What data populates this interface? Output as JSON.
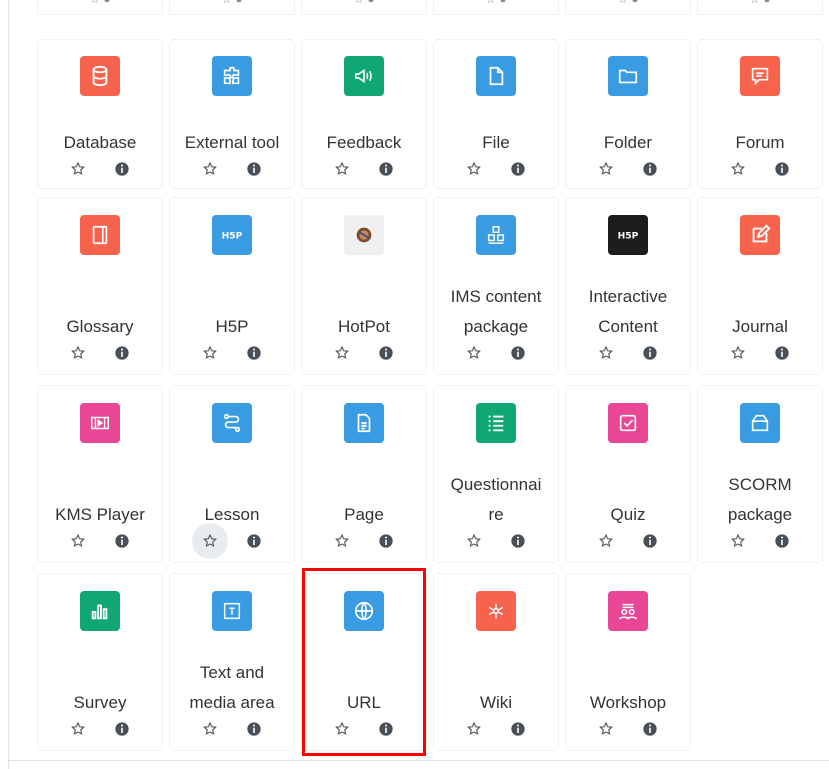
{
  "colors": {
    "orange": "#f7634d",
    "blue": "#399be2",
    "green": "#11a676",
    "pink": "#e94695",
    "hotpot": "#f0f0f0",
    "black": "#1d1d1b",
    "highlight": "#ff0000"
  },
  "tiles": [
    {
      "label": "Database",
      "icon": "database-icon",
      "color": "orange"
    },
    {
      "label": "External tool",
      "icon": "puzzle-icon",
      "color": "blue"
    },
    {
      "label": "Feedback",
      "icon": "megaphone-icon",
      "color": "green"
    },
    {
      "label": "File",
      "icon": "file-icon",
      "color": "blue"
    },
    {
      "label": "Folder",
      "icon": "folder-icon",
      "color": "blue"
    },
    {
      "label": "Forum",
      "icon": "forum-icon",
      "color": "orange"
    },
    {
      "label": "Glossary",
      "icon": "book-icon",
      "color": "orange"
    },
    {
      "label": "H5P",
      "icon": "h5p-icon",
      "color": "blue",
      "text": "H5P"
    },
    {
      "label": "HotPot",
      "icon": "hotpot-icon",
      "color": "hotpot"
    },
    {
      "label": "IMS content package",
      "lines": [
        "IMS content",
        "package"
      ],
      "icon": "boxes-icon",
      "color": "blue"
    },
    {
      "label": "Interactive Content",
      "lines": [
        "Interactive",
        "Content"
      ],
      "icon": "h5p-interactive-icon",
      "color": "black",
      "text": "H5P"
    },
    {
      "label": "Journal",
      "icon": "edit-icon",
      "color": "orange"
    },
    {
      "label": "KMS Player",
      "icon": "film-icon",
      "color": "pink"
    },
    {
      "label": "Lesson",
      "icon": "path-icon",
      "color": "blue"
    },
    {
      "label": "Page",
      "icon": "page-icon",
      "color": "blue"
    },
    {
      "label": "Questionnaire",
      "lines": [
        "Questionnai",
        "re"
      ],
      "icon": "list-icon",
      "color": "green"
    },
    {
      "label": "Quiz",
      "icon": "checkbox-icon",
      "color": "pink"
    },
    {
      "label": "SCORM package",
      "lines": [
        "SCORM",
        "package"
      ],
      "icon": "package-icon",
      "color": "blue"
    },
    {
      "label": "Survey",
      "icon": "bar-chart-icon",
      "color": "green"
    },
    {
      "label": "Text and media area",
      "lines": [
        "Text and",
        "media area"
      ],
      "icon": "text-frame-icon",
      "color": "blue"
    },
    {
      "label": "URL",
      "icon": "globe-icon",
      "color": "blue"
    },
    {
      "label": "Wiki",
      "icon": "network-icon",
      "color": "orange"
    },
    {
      "label": "Workshop",
      "icon": "people-icon",
      "color": "pink"
    }
  ]
}
